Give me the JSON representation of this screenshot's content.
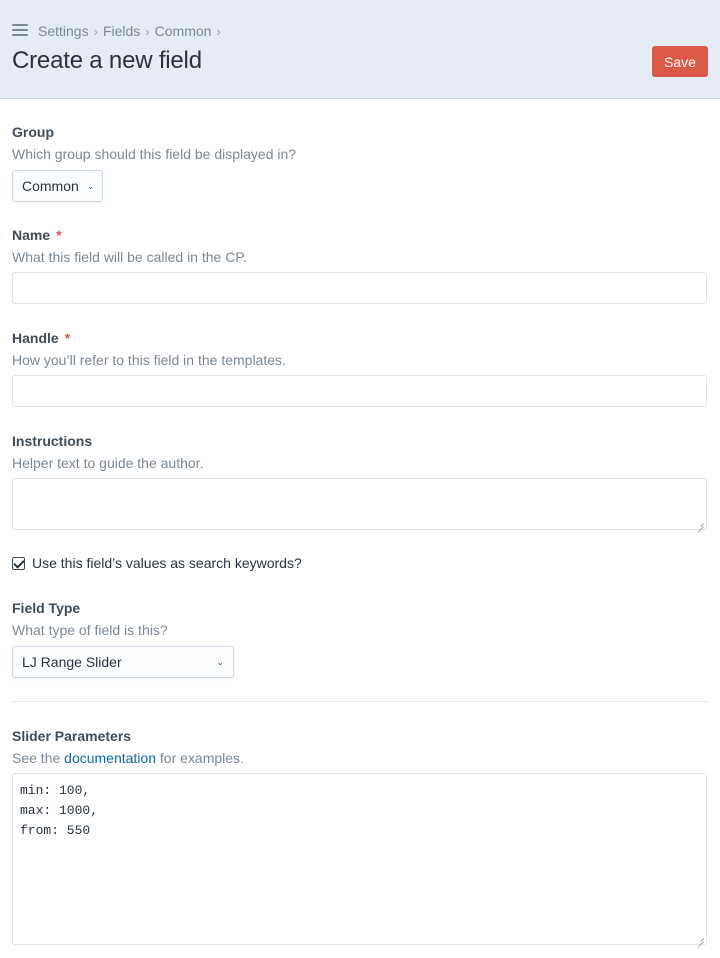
{
  "header": {
    "breadcrumbs": [
      "Settings",
      "Fields",
      "Common"
    ],
    "breadcrumb_separator": "›",
    "title": "Create a new field",
    "save_label": "Save"
  },
  "group": {
    "label": "Group",
    "instructions": "Which group should this field be displayed in?",
    "selected": "Common"
  },
  "name": {
    "label": "Name",
    "required_mark": "*",
    "instructions": "What this field will be called in the CP.",
    "value": ""
  },
  "handle": {
    "label": "Handle",
    "required_mark": "*",
    "instructions": "How you’ll refer to this field in the templates.",
    "value": ""
  },
  "field_instructions": {
    "label": "Instructions",
    "instructions": "Helper text to guide the author.",
    "value": ""
  },
  "searchable": {
    "label": "Use this field’s values as search keywords?",
    "checked": true
  },
  "field_type": {
    "label": "Field Type",
    "instructions": "What type of field is this?",
    "selected": "LJ Range Slider"
  },
  "slider_parameters": {
    "label": "Slider Parameters",
    "instructions_prefix": "See the ",
    "instructions_link": "documentation",
    "instructions_suffix": " for examples.",
    "lines": [
      "min: 100,",
      "max: 1000,",
      "from: 550"
    ]
  },
  "colors": {
    "header_bg": "#e4ecf5",
    "save_button": "#da5a47",
    "link": "#0b69a3",
    "required": "#da5a47"
  },
  "icons": {
    "menu": "hamburger-menu-icon",
    "dropdown": "chevron-down-icon",
    "resize": "resize-grip-icon"
  }
}
